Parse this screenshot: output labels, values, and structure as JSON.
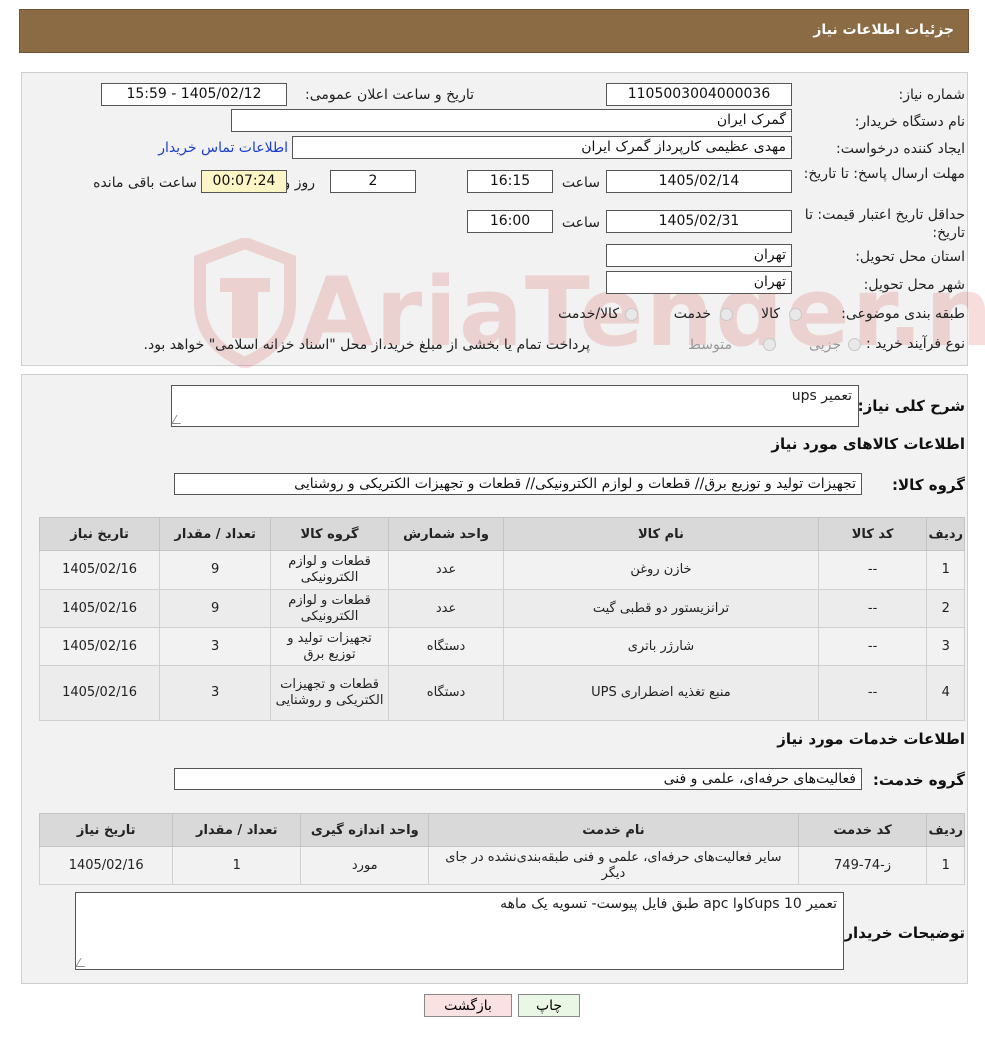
{
  "header": {
    "title": "جزئیات اطلاعات نیاز"
  },
  "watermark": {
    "text": "AriaTender.neT"
  },
  "form": {
    "need_number_label": "شماره نیاز:",
    "need_number": "1105003004000036",
    "announce_label": "تاریخ و ساعت اعلان عمومی:",
    "announce_value": "1405/02/12 - 15:59",
    "buyer_label": "نام دستگاه خریدار:",
    "buyer_value": "گمرک ایران",
    "creator_label": "ایجاد کننده درخواست:",
    "creator_value": "مهدی عظیمی کارپرداز گمرک ایران",
    "contact_link": "اطلاعات تماس خریدار",
    "deadline_label": "مهلت ارسال پاسخ: تا تاریخ:",
    "deadline_date": "1405/02/14",
    "time_label": "ساعت",
    "deadline_time": "16:15",
    "days_value": "2",
    "days_label": "روز و",
    "remaining_value": "00:07:24",
    "remaining_label": "ساعت باقی مانده",
    "validity_label": "حداقل تاریخ اعتبار قیمت: تا تاریخ:",
    "validity_date": "1405/02/31",
    "validity_time": "16:00",
    "province_label": "استان محل تحویل:",
    "province_value": "تهران",
    "city_label": "شهر محل تحویل:",
    "city_value": "تهران",
    "category_label": "طبقه بندی موضوعی:",
    "category_options": [
      "کالا",
      "خدمت",
      "کالا/خدمت"
    ],
    "process_label": "نوع فرآیند خرید :",
    "process_options": [
      "جزیی",
      "متوسط"
    ],
    "process_note": "پرداخت تمام یا بخشی از مبلغ خرید،از محل \"اسناد خزانه اسلامی\" خواهد بود."
  },
  "goods": {
    "summary_label": "شرح کلی نیاز:",
    "summary_value": "تعمیر ups",
    "section_title": "اطلاعات کالاهای مورد نیاز",
    "group_label": "گروه کالا:",
    "group_value": "تجهیزات تولید و توزیع برق// قطعات و لوازم الکترونیکی// قطعات و تجهیزات الکتریکی و روشنایی",
    "columns": [
      "ردیف",
      "کد کالا",
      "نام کالا",
      "واحد شمارش",
      "گروه کالا",
      "تعداد / مقدار",
      "تاریخ نیاز"
    ],
    "rows": [
      [
        "1",
        "--",
        "خازن روغن",
        "عدد",
        "قطعات و لوازم الکترونیکی",
        "9",
        "1405/02/16"
      ],
      [
        "2",
        "--",
        "ترانزیستور دو قطبی گیت",
        "عدد",
        "قطعات و لوازم الکترونیکی",
        "9",
        "1405/02/16"
      ],
      [
        "3",
        "--",
        "شارژر باتری",
        "دستگاه",
        "تجهیزات تولید و توزیع برق",
        "3",
        "1405/02/16"
      ],
      [
        "4",
        "--",
        "منبع تغذیه اضطراری UPS",
        "دستگاه",
        "قطعات و تجهیزات الکتریکی و روشنایی",
        "3",
        "1405/02/16"
      ]
    ]
  },
  "services": {
    "section_title": "اطلاعات خدمات مورد نیاز",
    "group_label": "گروه خدمت:",
    "group_value": "فعالیت‌های حرفه‌ای، علمی و فنی",
    "columns": [
      "ردیف",
      "کد خدمت",
      "نام خدمت",
      "واحد اندازه گیری",
      "تعداد / مقدار",
      "تاریخ نیاز"
    ],
    "rows": [
      [
        "1",
        "ز-74-749",
        "سایر فعالیت‌های حرفه‌ای، علمی و فنی طبقه‌بندی‌نشده در جای دیگر",
        "مورد",
        "1",
        "1405/02/16"
      ]
    ],
    "notes_label": "توضیحات خریدار:",
    "notes_value": "تعمیر 10 upsکاوا  apc طبق فایل پیوست- تسویه یک ماهه"
  },
  "actions": {
    "print": "چاپ",
    "back": "بازگشت"
  }
}
